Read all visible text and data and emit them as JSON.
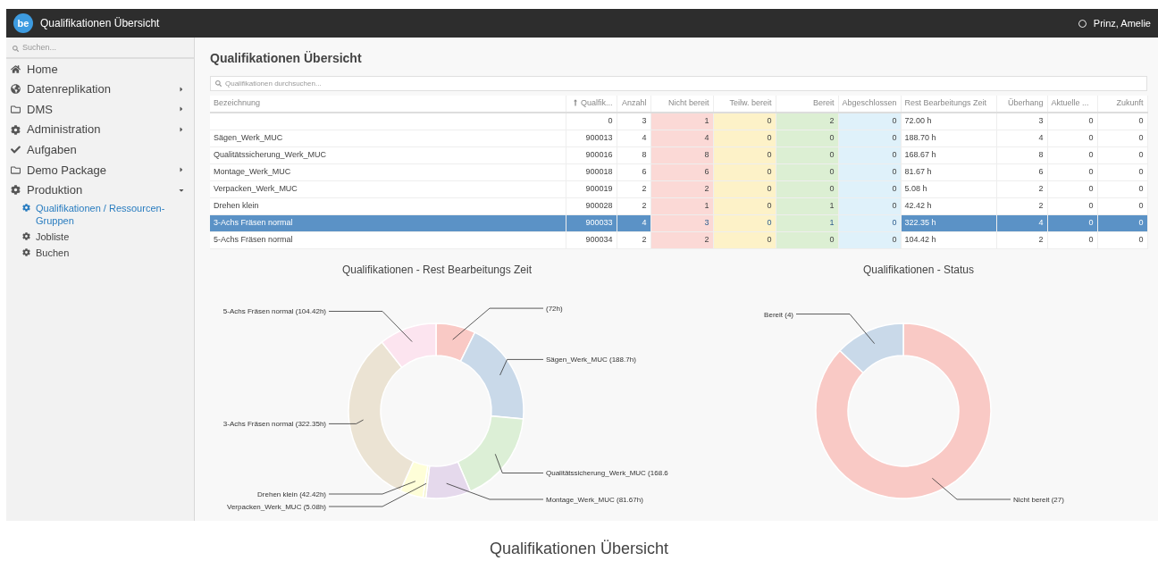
{
  "topbar": {
    "logo": "be",
    "title": "Qualifikationen Übersicht",
    "user": "Prinz, Amelie"
  },
  "sidebar": {
    "search": {
      "placeholder": "Suchen..."
    },
    "items": [
      {
        "label": "Home"
      },
      {
        "label": "Datenreplikation",
        "expanded": false
      },
      {
        "label": "DMS",
        "expanded": false
      },
      {
        "label": "Administration",
        "expanded": false
      },
      {
        "label": "Aufgaben"
      },
      {
        "label": "Demo Package",
        "expanded": false
      },
      {
        "label": "Produktion",
        "expanded": true,
        "children": [
          {
            "label": "Qualifikationen / Ressourcen-Gruppen",
            "selected": true
          },
          {
            "label": "Jobliste",
            "selected": false
          },
          {
            "label": "Buchen",
            "selected": false
          }
        ]
      }
    ]
  },
  "page": {
    "heading": "Qualifikationen Übersicht",
    "search": {
      "placeholder": "Qualifikationen durchsuchen..."
    }
  },
  "table": {
    "columns": [
      {
        "label": "Bezeichnung",
        "sorted": false
      },
      {
        "label": "Qualfik...",
        "sorted": true
      },
      {
        "label": "Anzahl",
        "sorted": false
      },
      {
        "label": "Nicht bereit",
        "sorted": false,
        "color": "#fbd9d6"
      },
      {
        "label": "Teilw. bereit",
        "sorted": false,
        "color": "#fdf2c8"
      },
      {
        "label": "Bereit",
        "sorted": false,
        "color": "#dcefd3"
      },
      {
        "label": "Abgeschlossen",
        "sorted": false,
        "color": "#dff1fa"
      },
      {
        "label": "Rest Bearbeitungs Zeit",
        "sorted": false
      },
      {
        "label": "Überhang",
        "sorted": false
      },
      {
        "label": "Aktuelle ...",
        "sorted": false
      },
      {
        "label": "Zukunft",
        "sorted": false
      }
    ],
    "rows": [
      {
        "selected": false,
        "cells": [
          "",
          "0",
          "3",
          "1",
          "0",
          "2",
          "0",
          "72.00 h",
          "3",
          "0",
          "0"
        ]
      },
      {
        "selected": false,
        "cells": [
          "Sägen_Werk_MUC",
          "900013",
          "4",
          "4",
          "0",
          "0",
          "0",
          "188.70 h",
          "4",
          "0",
          "0"
        ]
      },
      {
        "selected": false,
        "cells": [
          "Qualitätssicherung_Werk_MUC",
          "900016",
          "8",
          "8",
          "0",
          "0",
          "0",
          "168.67 h",
          "8",
          "0",
          "0"
        ]
      },
      {
        "selected": false,
        "cells": [
          "Montage_Werk_MUC",
          "900018",
          "6",
          "6",
          "0",
          "0",
          "0",
          "81.67 h",
          "6",
          "0",
          "0"
        ]
      },
      {
        "selected": false,
        "cells": [
          "Verpacken_Werk_MUC",
          "900019",
          "2",
          "2",
          "0",
          "0",
          "0",
          "5.08 h",
          "2",
          "0",
          "0"
        ]
      },
      {
        "selected": false,
        "cells": [
          "Drehen klein",
          "900028",
          "2",
          "1",
          "0",
          "1",
          "0",
          "42.42 h",
          "2",
          "0",
          "0"
        ]
      },
      {
        "selected": true,
        "cells": [
          "3-Achs Fräsen normal",
          "900033",
          "4",
          "3",
          "0",
          "1",
          "0",
          "322.35 h",
          "4",
          "0",
          "0"
        ]
      },
      {
        "selected": false,
        "cells": [
          "5-Achs Fräsen normal",
          "900034",
          "2",
          "2",
          "0",
          "0",
          "0",
          "104.42 h",
          "2",
          "0",
          "0"
        ]
      }
    ]
  },
  "charts": [
    {
      "chart_data": {
        "type": "donut",
        "title": "Qualifikationen - Rest Bearbeitungs Zeit",
        "series": [
          {
            "values": [
              7.31,
              19.15,
              17.12,
              8.29,
              0.52,
              4.31,
              32.7,
              10.6
            ]
          }
        ],
        "value_labels": [
          "(72h)",
          "Sägen_Werk_MUC (188.7h)",
          "Qualitätssicherung_Werk_MUC (168.6",
          "Montage_Werk_MUC (81.67h)",
          "Verpacken_Werk_MUC (5.08h)",
          "Drehen klein (42.42h)",
          "3-Achs Fräsen normal (322.35h)",
          "5-Achs Fräsen normal (104.42h)"
        ]
      }
    },
    {
      "chart_data": {
        "type": "donut",
        "title": "Qualifikationen - Status",
        "series": [
          {
            "values": [
              87.1,
              12.9
            ]
          }
        ],
        "value_labels": [
          "Nicht bereit (27)",
          "Bereit (4)"
        ]
      }
    }
  ],
  "caption": "Qualifikationen Übersicht"
}
